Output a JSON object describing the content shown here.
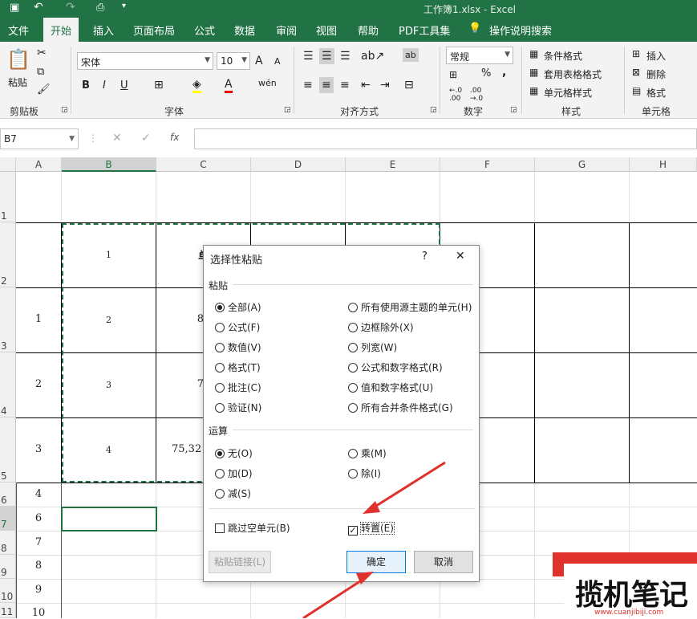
{
  "window": {
    "title": "工作簿1.xlsx  -  Excel"
  },
  "menu": [
    "文件",
    "开始",
    "插入",
    "页面布局",
    "公式",
    "数据",
    "审阅",
    "视图",
    "帮助",
    "PDF工具集",
    "操作说明搜索"
  ],
  "ribbon": {
    "clipboard": {
      "paste": "粘贴",
      "label": "剪贴板"
    },
    "font": {
      "name": "宋体",
      "size": "10",
      "label": "字体",
      "bold": "B",
      "italic": "I",
      "underline": "U",
      "grow": "A",
      "shrink": "A"
    },
    "alignment": {
      "label": "对齐方式"
    },
    "number": {
      "format": "常规",
      "label": "数字",
      "percent": "%",
      "comma": ","
    },
    "styles": {
      "conditional": "条件格式",
      "table": "套用表格格式",
      "cell": "单元格样式",
      "label": "样式"
    },
    "cells": {
      "insert": "插入",
      "delete": "删除",
      "format": "格式",
      "label": "单元格"
    }
  },
  "formula_bar": {
    "name_box": "B7",
    "fx": "fx"
  },
  "columns": [
    "A",
    "B",
    "C",
    "D",
    "E",
    "F",
    "G",
    "H"
  ],
  "rows": [
    "1",
    "2",
    "3",
    "4",
    "5",
    "6",
    "7",
    "8",
    "9",
    "10",
    "11"
  ],
  "cells": {
    "A3": "1",
    "A4": "2",
    "A5": "3",
    "A6": "4",
    "A7": "6",
    "A8": "7",
    "A9": "8",
    "A10": "9",
    "A11": "10",
    "B2": "1",
    "B3": "2",
    "B4": "3",
    "B5": "4",
    "C2": "单",
    "C3": "87",
    "C4": "77",
    "C5": "75,32"
  },
  "dialog": {
    "title": "选择性粘贴",
    "help": "?",
    "close": "✕",
    "paste_label": "粘贴",
    "paste_left": [
      "全部(A)",
      "公式(F)",
      "数值(V)",
      "格式(T)",
      "批注(C)",
      "验证(N)"
    ],
    "paste_right": [
      "所有使用源主题的单元(H)",
      "边框除外(X)",
      "列宽(W)",
      "公式和数字格式(R)",
      "值和数字格式(U)",
      "所有合并条件格式(G)"
    ],
    "operation_label": "运算",
    "op_left": [
      "无(O)",
      "加(D)",
      "减(S)"
    ],
    "op_right": [
      "乘(M)",
      "除(I)"
    ],
    "skip_blanks": "跳过空单元(B)",
    "transpose": "转置(E)",
    "paste_link": "粘贴链接(L)",
    "ok": "确定",
    "cancel": "取消"
  },
  "watermark": {
    "text": "揽机笔记",
    "url": "www.cuanjibiji.com"
  },
  "colors": {
    "excel_green": "#217346",
    "arrow": "#e0322c"
  }
}
